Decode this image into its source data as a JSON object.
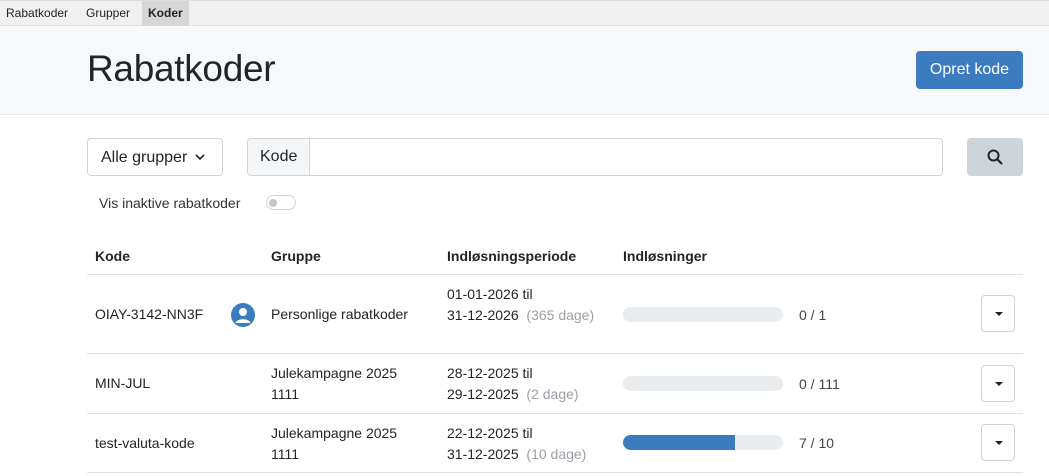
{
  "topnav": {
    "tabs": [
      {
        "label": "Rabatkoder"
      },
      {
        "label": "Grupper"
      },
      {
        "label": "Koder"
      }
    ]
  },
  "header": {
    "title": "Rabatkoder",
    "create_label": "Opret kode"
  },
  "filters": {
    "group_select_value": "Alle grupper",
    "search_addon": "Kode",
    "search_value": "",
    "inactive_label": "Vis inaktive rabatkoder",
    "inactive_enabled": false
  },
  "table": {
    "headers": [
      "Kode",
      "Gruppe",
      "Indløsningsperiode",
      "Indløsninger"
    ],
    "rows": [
      {
        "code": "OIAY-3142-NN3F",
        "personal": true,
        "group_line1": "Personlige rabatkoder",
        "group_line2": "",
        "period_line1": "01-01-2026 til",
        "period_line2": "31-12-2026",
        "period_days": "(365 dage)",
        "redeemed": 0,
        "max": 1,
        "count": "0 / 1"
      },
      {
        "code": "MIN-JUL",
        "personal": false,
        "group_line1": "Julekampagne 2025",
        "group_line2": "1111",
        "period_line1": "28-12-2025 til",
        "period_line2": "29-12-2025",
        "period_days": "(2 dage)",
        "redeemed": 0,
        "max": 111,
        "count": "0 / 111"
      },
      {
        "code": "test-valuta-kode",
        "personal": false,
        "group_line1": "Julekampagne 2025",
        "group_line2": "1111",
        "period_line1": "22-12-2025 til",
        "period_line2": "31-12-2025",
        "period_days": "(10 dage)",
        "redeemed": 7,
        "max": 10,
        "count": "7 / 10"
      }
    ]
  },
  "colors": {
    "primary": "#3b7bbf",
    "bar_track": "#e9ecef"
  }
}
